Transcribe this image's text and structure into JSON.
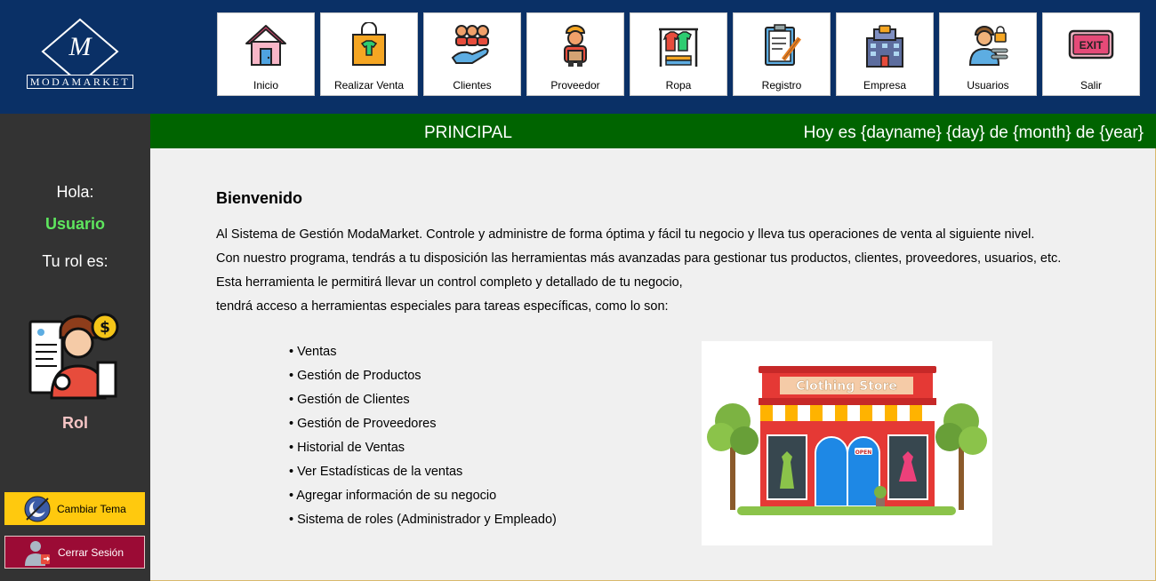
{
  "logo": {
    "letter": "M",
    "text": "MODAMARKET"
  },
  "nav": [
    {
      "label": "Inicio",
      "icon": "home-icon"
    },
    {
      "label": "Realizar Venta",
      "icon": "shopping-bag-icon"
    },
    {
      "label": "Clientes",
      "icon": "clients-icon"
    },
    {
      "label": "Proveedor",
      "icon": "supplier-icon"
    },
    {
      "label": "Ropa",
      "icon": "clothes-rack-icon"
    },
    {
      "label": "Registro",
      "icon": "clipboard-icon"
    },
    {
      "label": "Empresa",
      "icon": "building-icon"
    },
    {
      "label": "Usuarios",
      "icon": "users-lock-icon"
    },
    {
      "label": "Salir",
      "icon": "exit-icon"
    }
  ],
  "exit_sign": "EXIT",
  "sidebar": {
    "greeting": "Hola:",
    "username": "Usuario",
    "role_label": "Tu rol es:",
    "role": "Rol",
    "theme_button": "Cambiar Tema",
    "logout_button": "Cerrar Sesión"
  },
  "bar": {
    "title": "PRINCIPAL",
    "date": "Hoy es {dayname} {day} de {month} de {year}"
  },
  "content": {
    "title": "Bienvenido",
    "paragraphs": [
      "Al Sistema de Gestión ModaMarket. Controle y administre de forma óptima y fácil tu negocio y lleva tus operaciones de venta al siguiente nivel.",
      "Con nuestro programa, tendrás a tu disposición las herramientas más avanzadas para gestionar tus productos, clientes, proveedores, usuarios, etc.",
      "Esta herramienta le permitirá llevar un control completo y detallado de tu negocio,",
      "tendrá acceso a herramientas especiales para tareas específicas, como lo son:"
    ],
    "features": [
      "• Ventas",
      "• Gestión de Productos",
      "• Gestión de Clientes",
      "• Gestión de Proveedores",
      "• Historial de Ventas",
      "• Ver Estadísticas de la ventas",
      "• Agregar información de su negocio",
      "• Sistema de roles (Administrador y Empleado)"
    ],
    "store_sign": "Clothing Store",
    "store_door_sign": "OPEN"
  },
  "colors": {
    "header": "#0a3066",
    "sidebar": "#333333",
    "greenbar": "#006400",
    "username": "#5ee65e",
    "role": "#f6c5c5",
    "theme_button": "#ffc90e",
    "logout_button": "#9b0b35"
  }
}
